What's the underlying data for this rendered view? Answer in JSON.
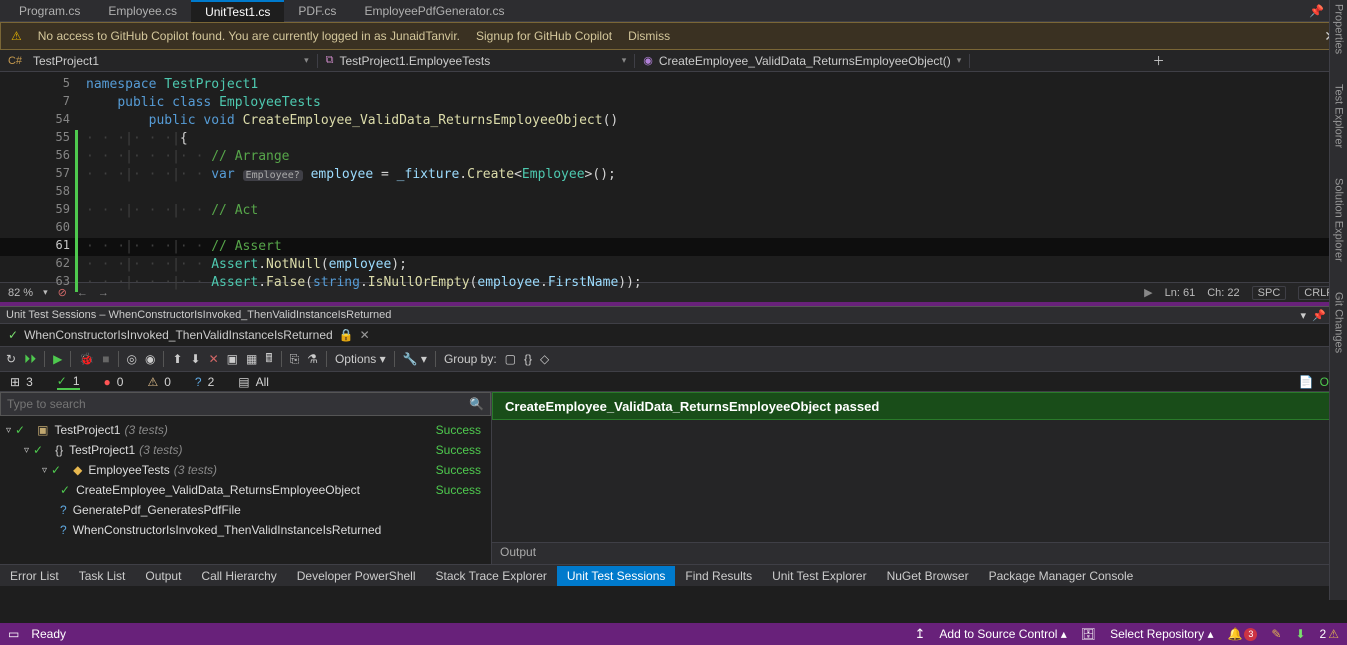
{
  "tabs": [
    "Program.cs",
    "Employee.cs",
    "UnitTest1.cs",
    "PDF.cs",
    "EmployeePdfGenerator.cs"
  ],
  "activeTab": 2,
  "notification": {
    "text": "No access to GitHub Copilot found. You are currently logged in as JunaidTanvir.",
    "signup": "Signup for GitHub Copilot",
    "dismiss": "Dismiss"
  },
  "breadcrumb": {
    "project": "TestProject1",
    "namespace": "TestProject1.EmployeeTests",
    "method": "CreateEmployee_ValidData_ReturnsEmployeeObject()"
  },
  "code": {
    "lines": [
      {
        "n": 5,
        "html": "<span class='kw'>namespace</span> <span class='type'>TestProject1</span>"
      },
      {
        "n": 7,
        "html": "    <span class='kw'>public</span> <span class='kw'>class</span> <span class='type'>EmployeeTests</span>"
      },
      {
        "n": 54,
        "html": "        <span class='kw'>public</span> <span class='kw'>void</span> <span class='method'>CreateEmployee_ValidData_ReturnsEmployeeObject</span><span class='punc'>()</span>"
      },
      {
        "n": 55,
        "html": "<span class='guide'>· · ·|· · ·|</span><span class='punc'>{</span>",
        "green": true
      },
      {
        "n": 56,
        "html": "<span class='guide'>· · ·|· · ·|· · </span><span class='comment'>// Arrange</span>",
        "green": true
      },
      {
        "n": 57,
        "html": "<span class='guide'>· · ·|· · ·|· · </span><span class='kw'>var</span> <span class='hint'>Employee?</span> <span class='param'>employee</span> <span class='punc'>=</span> <span class='param'>_fixture</span><span class='punc'>.</span><span class='method'>Create</span><span class='punc'>&lt;</span><span class='type'>Employee</span><span class='punc'>&gt;();</span>",
        "green": true
      },
      {
        "n": 58,
        "html": "",
        "green": true
      },
      {
        "n": 59,
        "html": "<span class='guide'>· · ·|· · ·|· · </span><span class='comment'>// Act</span>",
        "green": true
      },
      {
        "n": 60,
        "html": "",
        "green": true
      },
      {
        "n": 61,
        "html": "<span class='guide'>· · ·|· · ·|· · </span><span class='comment'>// Assert</span>",
        "green": true,
        "curr": true
      },
      {
        "n": 62,
        "html": "<span class='guide'>· · ·|· · ·|· · </span><span class='type'>Assert</span><span class='punc'>.</span><span class='method'>NotNull</span><span class='punc'>(</span><span class='param'>employee</span><span class='punc'>);</span>",
        "green": true
      },
      {
        "n": 63,
        "html": "<span class='guide'>· · ·|· · ·|· · </span><span class='type'>Assert</span><span class='punc'>.</span><span class='method'>False</span><span class='punc'>(</span><span class='kw'>string</span><span class='punc'>.</span><span class='method'>IsNullOrEmpty</span><span class='punc'>(</span><span class='param'>employee</span><span class='punc'>.</span><span class='param'>FirstName</span><span class='punc'>));</span>",
        "green": true
      }
    ]
  },
  "editorStatus": {
    "zoom": "82 %",
    "ln": "Ln: 61",
    "ch": "Ch: 22",
    "spc": "SPC",
    "crlf": "CRLF"
  },
  "sessions": {
    "header": "Unit Test Sessions – WhenConstructorIsInvoked_ThenValidInstanceIsReturned",
    "tab": "WhenConstructorIsInvoked_ThenValidInstanceIsReturned",
    "options": "Options",
    "groupby": "Group by:",
    "all": "All",
    "counts": {
      "total": "3",
      "pass": "1",
      "fail": "0",
      "warn": "0",
      "pend": "2",
      "ok": "OK"
    },
    "searchPlaceholder": "Type to search",
    "resultBanner": "CreateEmployee_ValidData_ReturnsEmployeeObject passed",
    "output": "Output"
  },
  "tree": [
    {
      "indent": 0,
      "chev": "▿",
      "icon": "proj",
      "name": "TestProject1",
      "count": "(3 tests)",
      "status": "Success",
      "ok": true
    },
    {
      "indent": 1,
      "chev": "▿",
      "icon": "ns",
      "name": "TestProject1",
      "count": "(3 tests)",
      "status": "Success",
      "ok": true
    },
    {
      "indent": 2,
      "chev": "▿",
      "icon": "class",
      "name": "EmployeeTests",
      "count": "(3 tests)",
      "status": "Success",
      "ok": true
    },
    {
      "indent": 3,
      "chev": "",
      "icon": "",
      "name": "CreateEmployee_ValidData_ReturnsEmployeeObject",
      "count": "",
      "status": "Success",
      "ok": true
    },
    {
      "indent": 3,
      "chev": "",
      "icon": "",
      "name": "GeneratePdf_GeneratesPdfFile",
      "count": "",
      "status": "",
      "ok": false
    },
    {
      "indent": 3,
      "chev": "",
      "icon": "",
      "name": "WhenConstructorIsInvoked_ThenValidInstanceIsReturned",
      "count": "",
      "status": "",
      "ok": false
    }
  ],
  "panelTabs": [
    "Error List",
    "Task List",
    "Output",
    "Call Hierarchy",
    "Developer PowerShell",
    "Stack Trace Explorer",
    "Unit Test Sessions",
    "Find Results",
    "Unit Test Explorer",
    "NuGet Browser",
    "Package Manager Console"
  ],
  "activePanel": 6,
  "statusbar": {
    "ready": "Ready",
    "sourceControl": "Add to Source Control",
    "selectRepo": "Select Repository",
    "bell": "3",
    "warn2": "2"
  },
  "dock": [
    "Properties",
    "Test Explorer",
    "Solution Explorer",
    "Git Changes"
  ]
}
